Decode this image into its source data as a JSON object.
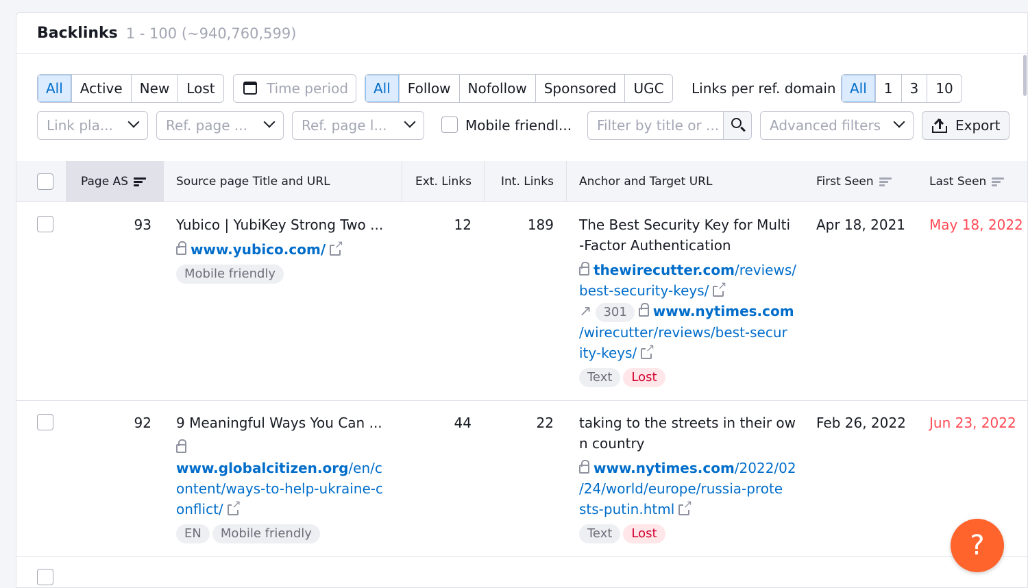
{
  "header": {
    "title": "Backlinks",
    "count": "1 - 100 (~940,760,599)"
  },
  "filters": {
    "status": [
      "All",
      "Active",
      "New",
      "Lost"
    ],
    "time_period": "Time period",
    "follow": [
      "All",
      "Follow",
      "Nofollow",
      "Sponsored",
      "UGC"
    ],
    "links_per_domain_label": "Links per ref. domain",
    "links_per_domain": [
      "All",
      "1",
      "3",
      "10"
    ],
    "link_placement": "Link pla...",
    "ref_page_type": "Ref. page ...",
    "ref_page_lang": "Ref. page l...",
    "mobile_friendly": "Mobile friendl...",
    "search_placeholder": "Filter by title or ...",
    "advanced_filters": "Advanced filters",
    "export": "Export"
  },
  "columns": {
    "page_as": "Page AS",
    "source": "Source page Title and URL",
    "ext_links": "Ext. Links",
    "int_links": "Int. Links",
    "anchor": "Anchor and Target URL",
    "first_seen": "First Seen",
    "last_seen": "Last Seen"
  },
  "rows": [
    {
      "page_as": "93",
      "source_title": "Yubico | YubiKey Strong Two ...",
      "source_url_domain": "www.yubico.com/",
      "source_tags": [
        "Mobile friendly"
      ],
      "ext_links": "12",
      "int_links": "189",
      "anchor_line1": "The Best Security Key for Multi",
      "anchor_line2": "-Factor Authentication",
      "target_domain": "thewirecutter.com",
      "target_path1": "/reviews/",
      "target_path2": "best-security-keys/",
      "redirect_code": "301",
      "redirect_domain": "www.nytimes.com",
      "redirect_path1": "/wirecutter/reviews/best-secur",
      "redirect_path2": "ity-keys/",
      "tag_type": "Text",
      "tag_status": "Lost",
      "first_seen": "Apr 18, 2021",
      "last_seen": "May 18, 2022"
    },
    {
      "page_as": "92",
      "source_title": "9 Meaningful Ways You Can ...",
      "source_url_domain": "www.globalcitizen.org",
      "source_url_path1": "/en/c",
      "source_url_path2": "ontent/ways-to-help-ukraine-c",
      "source_url_path3": "onflict/",
      "source_tags": [
        "EN",
        "Mobile friendly"
      ],
      "ext_links": "44",
      "int_links": "22",
      "anchor_line1": "taking to the streets in their ow",
      "anchor_line2": "n country",
      "target_domain": "www.nytimes.com",
      "target_path1": "/2022/02",
      "target_path2": "/24/world/europe/russia-prote",
      "target_path3": "sts-putin.html",
      "tag_type": "Text",
      "tag_status": "Lost",
      "first_seen": "Feb 26, 2022",
      "last_seen": "Jun 23, 2022"
    }
  ],
  "help_button": "?"
}
